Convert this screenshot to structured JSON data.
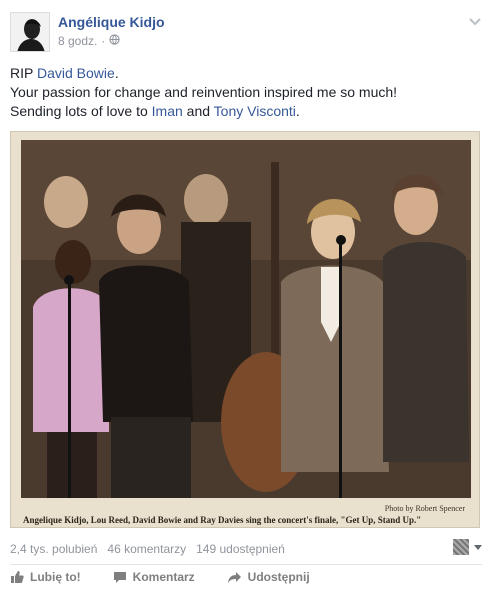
{
  "post": {
    "author": "Angélique Kidjo",
    "time": "8 godz.",
    "privacy_icon": "globe-icon",
    "menu_icon": "chevron-down-icon",
    "text": {
      "line1_prefix": "RIP ",
      "line1_link": "David Bowie",
      "line1_suffix": ".",
      "line2": "Your passion for change and reinvention inspired me so much!",
      "line3_prefix": "Sending lots of love to ",
      "line3_link1": "Iman",
      "line3_mid": " and ",
      "line3_link2": "Tony Visconti",
      "line3_suffix": "."
    },
    "photo": {
      "credit": "Photo by Robert Spencer",
      "caption": "Angelique Kidjo, Lou Reed, David Bowie and Ray Davies sing the concert's finale, \"Get Up, Stand Up.\""
    }
  },
  "stats": {
    "likes": "2,4 tys. polubień",
    "comments": "46 komentarzy",
    "shares": "149 udostępnień"
  },
  "actions": {
    "like": "Lubię to!",
    "comment": "Komentarz",
    "share": "Udostępnij"
  },
  "colors": {
    "link": "#365899",
    "muted": "#90949c",
    "action": "#7f7f7f"
  }
}
